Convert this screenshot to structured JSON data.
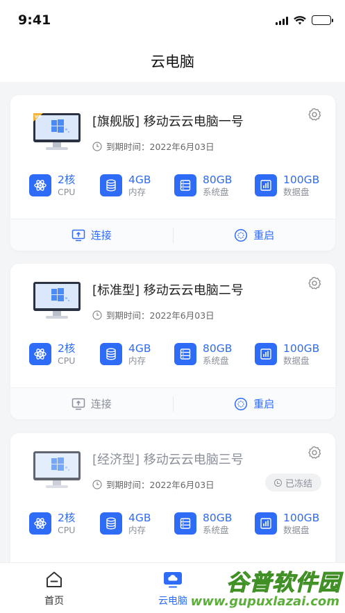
{
  "status_bar": {
    "time": "9:41"
  },
  "nav": {
    "title": "云电脑"
  },
  "colors": {
    "accent": "#2e6bf6",
    "muted": "#8a8f99",
    "background": "#f4f5f7"
  },
  "cards": [
    {
      "title": "[旗舰版] 移动云云电脑一号",
      "expiry": "到期时间：2022年6月03日",
      "badge": "VIP",
      "specs": [
        {
          "value": "2核",
          "label": "CPU",
          "icon": "atom-icon"
        },
        {
          "value": "4GB",
          "label": "内存",
          "icon": "database-icon"
        },
        {
          "value": "80GB",
          "label": "系统盘",
          "icon": "server-icon"
        },
        {
          "value": "100GB",
          "label": "数据盘",
          "icon": "bar-chart-icon"
        }
      ],
      "actions": {
        "connect": "连接",
        "restart": "重启"
      }
    },
    {
      "title": "[标准型] 移动云云电脑二号",
      "expiry": "到期时间：2022年6月03日",
      "specs": [
        {
          "value": "2核",
          "label": "CPU",
          "icon": "atom-icon"
        },
        {
          "value": "4GB",
          "label": "内存",
          "icon": "database-icon"
        },
        {
          "value": "80GB",
          "label": "系统盘",
          "icon": "server-icon"
        },
        {
          "value": "100GB",
          "label": "数据盘",
          "icon": "bar-chart-icon"
        }
      ],
      "actions": {
        "connect": "连接",
        "restart": "重启"
      }
    },
    {
      "title": "[经济型] 移动云云电脑三号",
      "expiry": "到期时间：2022年6月03日",
      "status": "已冻结",
      "specs": [
        {
          "value": "2核",
          "label": "CPU",
          "icon": "atom-icon"
        },
        {
          "value": "4GB",
          "label": "内存",
          "icon": "database-icon"
        },
        {
          "value": "80GB",
          "label": "系统盘",
          "icon": "server-icon"
        },
        {
          "value": "100GB",
          "label": "数据盘",
          "icon": "bar-chart-icon"
        }
      ]
    }
  ],
  "tabs": [
    {
      "label": "首页",
      "icon": "home-icon"
    },
    {
      "label": "云电脑",
      "icon": "cloud-computer-icon",
      "active": true
    }
  ],
  "watermark": {
    "text": "谷普软件园",
    "url": "www.gupuxlazai.com"
  }
}
